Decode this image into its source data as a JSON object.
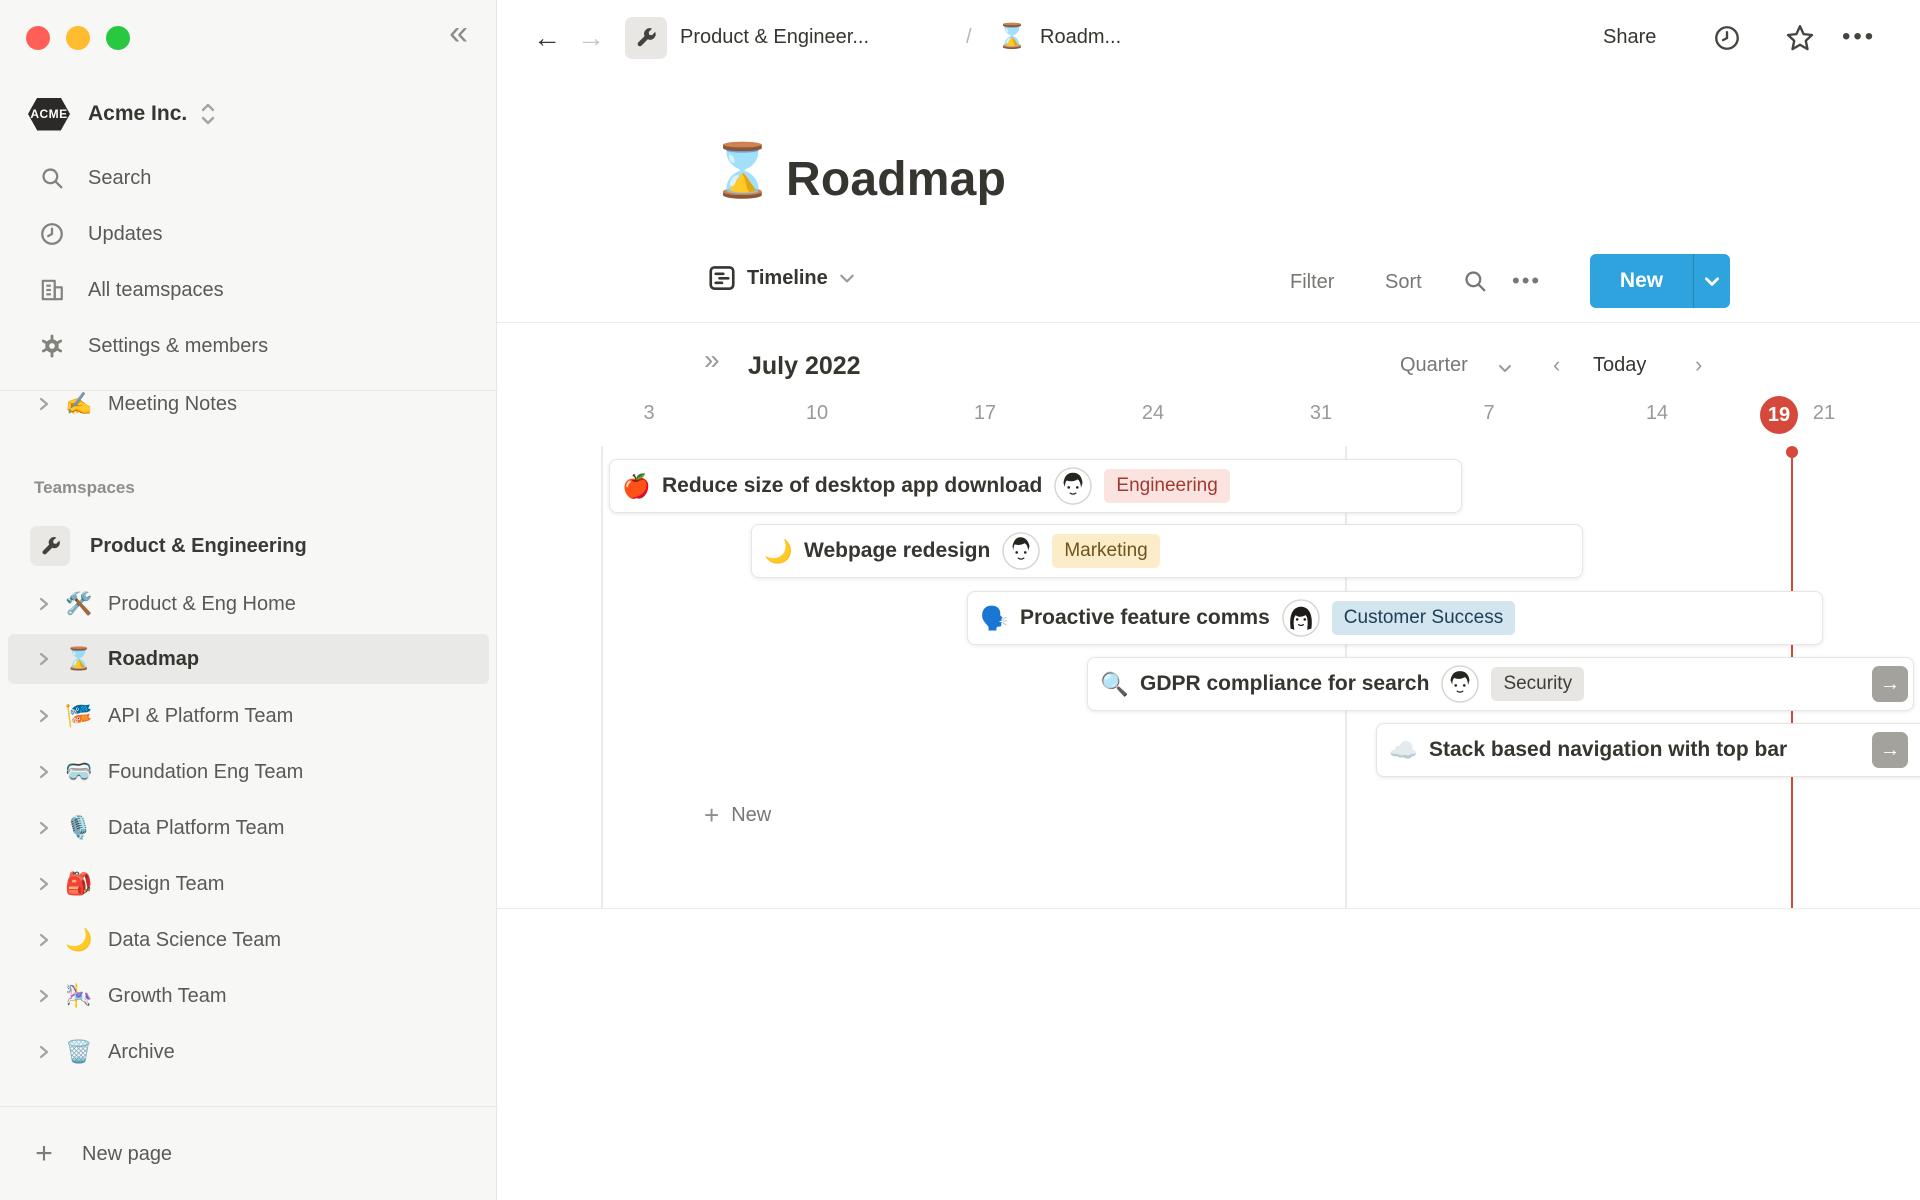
{
  "window": {
    "buttons": [
      "close",
      "minimize",
      "zoom"
    ]
  },
  "sidebar": {
    "workspace_logo": "ACME",
    "workspace_name": "Acme Inc.",
    "nav": [
      {
        "icon": "search-icon",
        "label": "Search"
      },
      {
        "icon": "clock-icon",
        "label": "Updates"
      },
      {
        "icon": "buildings-icon",
        "label": "All teamspaces"
      },
      {
        "icon": "gear-icon",
        "label": "Settings & members"
      }
    ],
    "pages": [
      {
        "emoji": "✍️",
        "label": "Meeting Notes"
      }
    ],
    "teamspaces_header": "Teamspaces",
    "teamspaces": [
      {
        "icon": "wrench-icon",
        "label": "Product & Engineering"
      },
      {
        "emoji": "🛠️",
        "label": "Product & Eng Home"
      },
      {
        "emoji": "⌛",
        "label": "Roadmap",
        "selected": true
      },
      {
        "emoji": "🎏",
        "label": "API & Platform Team"
      },
      {
        "emoji": "🥽",
        "label": "Foundation Eng Team"
      },
      {
        "emoji": "🎙️",
        "label": "Data Platform Team"
      },
      {
        "emoji": "🎒",
        "label": "Design Team"
      },
      {
        "emoji": "🌙",
        "label": "Data Science Team"
      },
      {
        "emoji": "🎠",
        "label": "Growth Team"
      },
      {
        "emoji": "🗑️",
        "label": "Archive"
      }
    ],
    "new_page": "New page"
  },
  "topbar": {
    "breadcrumb_teamspace": "Product & Engineer...",
    "breadcrumb_separator": "/",
    "breadcrumb_page_emoji": "⌛",
    "breadcrumb_page": "Roadm...",
    "share": "Share"
  },
  "page": {
    "emoji": "⌛",
    "title": "Roadmap"
  },
  "view_bar": {
    "view_label": "Timeline",
    "filter": "Filter",
    "sort": "Sort",
    "new_label": "New",
    "accent_color": "#2fa3de"
  },
  "timeline": {
    "period_label": "July 2022",
    "zoom_label": "Quarter",
    "today_button": "Today",
    "dates": [
      "3",
      "10",
      "17",
      "24",
      "31",
      "7",
      "14",
      "21"
    ],
    "today_date": "19",
    "today_color": "#d4493b",
    "new_item": "New",
    "items": [
      {
        "emoji": "🍎",
        "title": "Reduce size of desktop app download",
        "team": "Engineering",
        "tag_bg": "#fbe4e0",
        "tag_color": "#9f3a33"
      },
      {
        "emoji": "🌙",
        "title": "Webpage redesign",
        "team": "Marketing",
        "tag_bg": "#fdecc8",
        "tag_color": "#6f5423"
      },
      {
        "emoji": "🗣️",
        "title": "Proactive feature comms",
        "team": "Customer Success",
        "tag_bg": "#d3e5ef",
        "tag_color": "#1d3d56"
      },
      {
        "emoji": "🔍",
        "title": "GDPR compliance for search",
        "team": "Security",
        "tag_bg": "#e7e6e3",
        "tag_color": "#3f3d39",
        "continues": true
      },
      {
        "emoji": "☁️",
        "title": "Stack based navigation with top bar",
        "continues": true
      }
    ]
  }
}
